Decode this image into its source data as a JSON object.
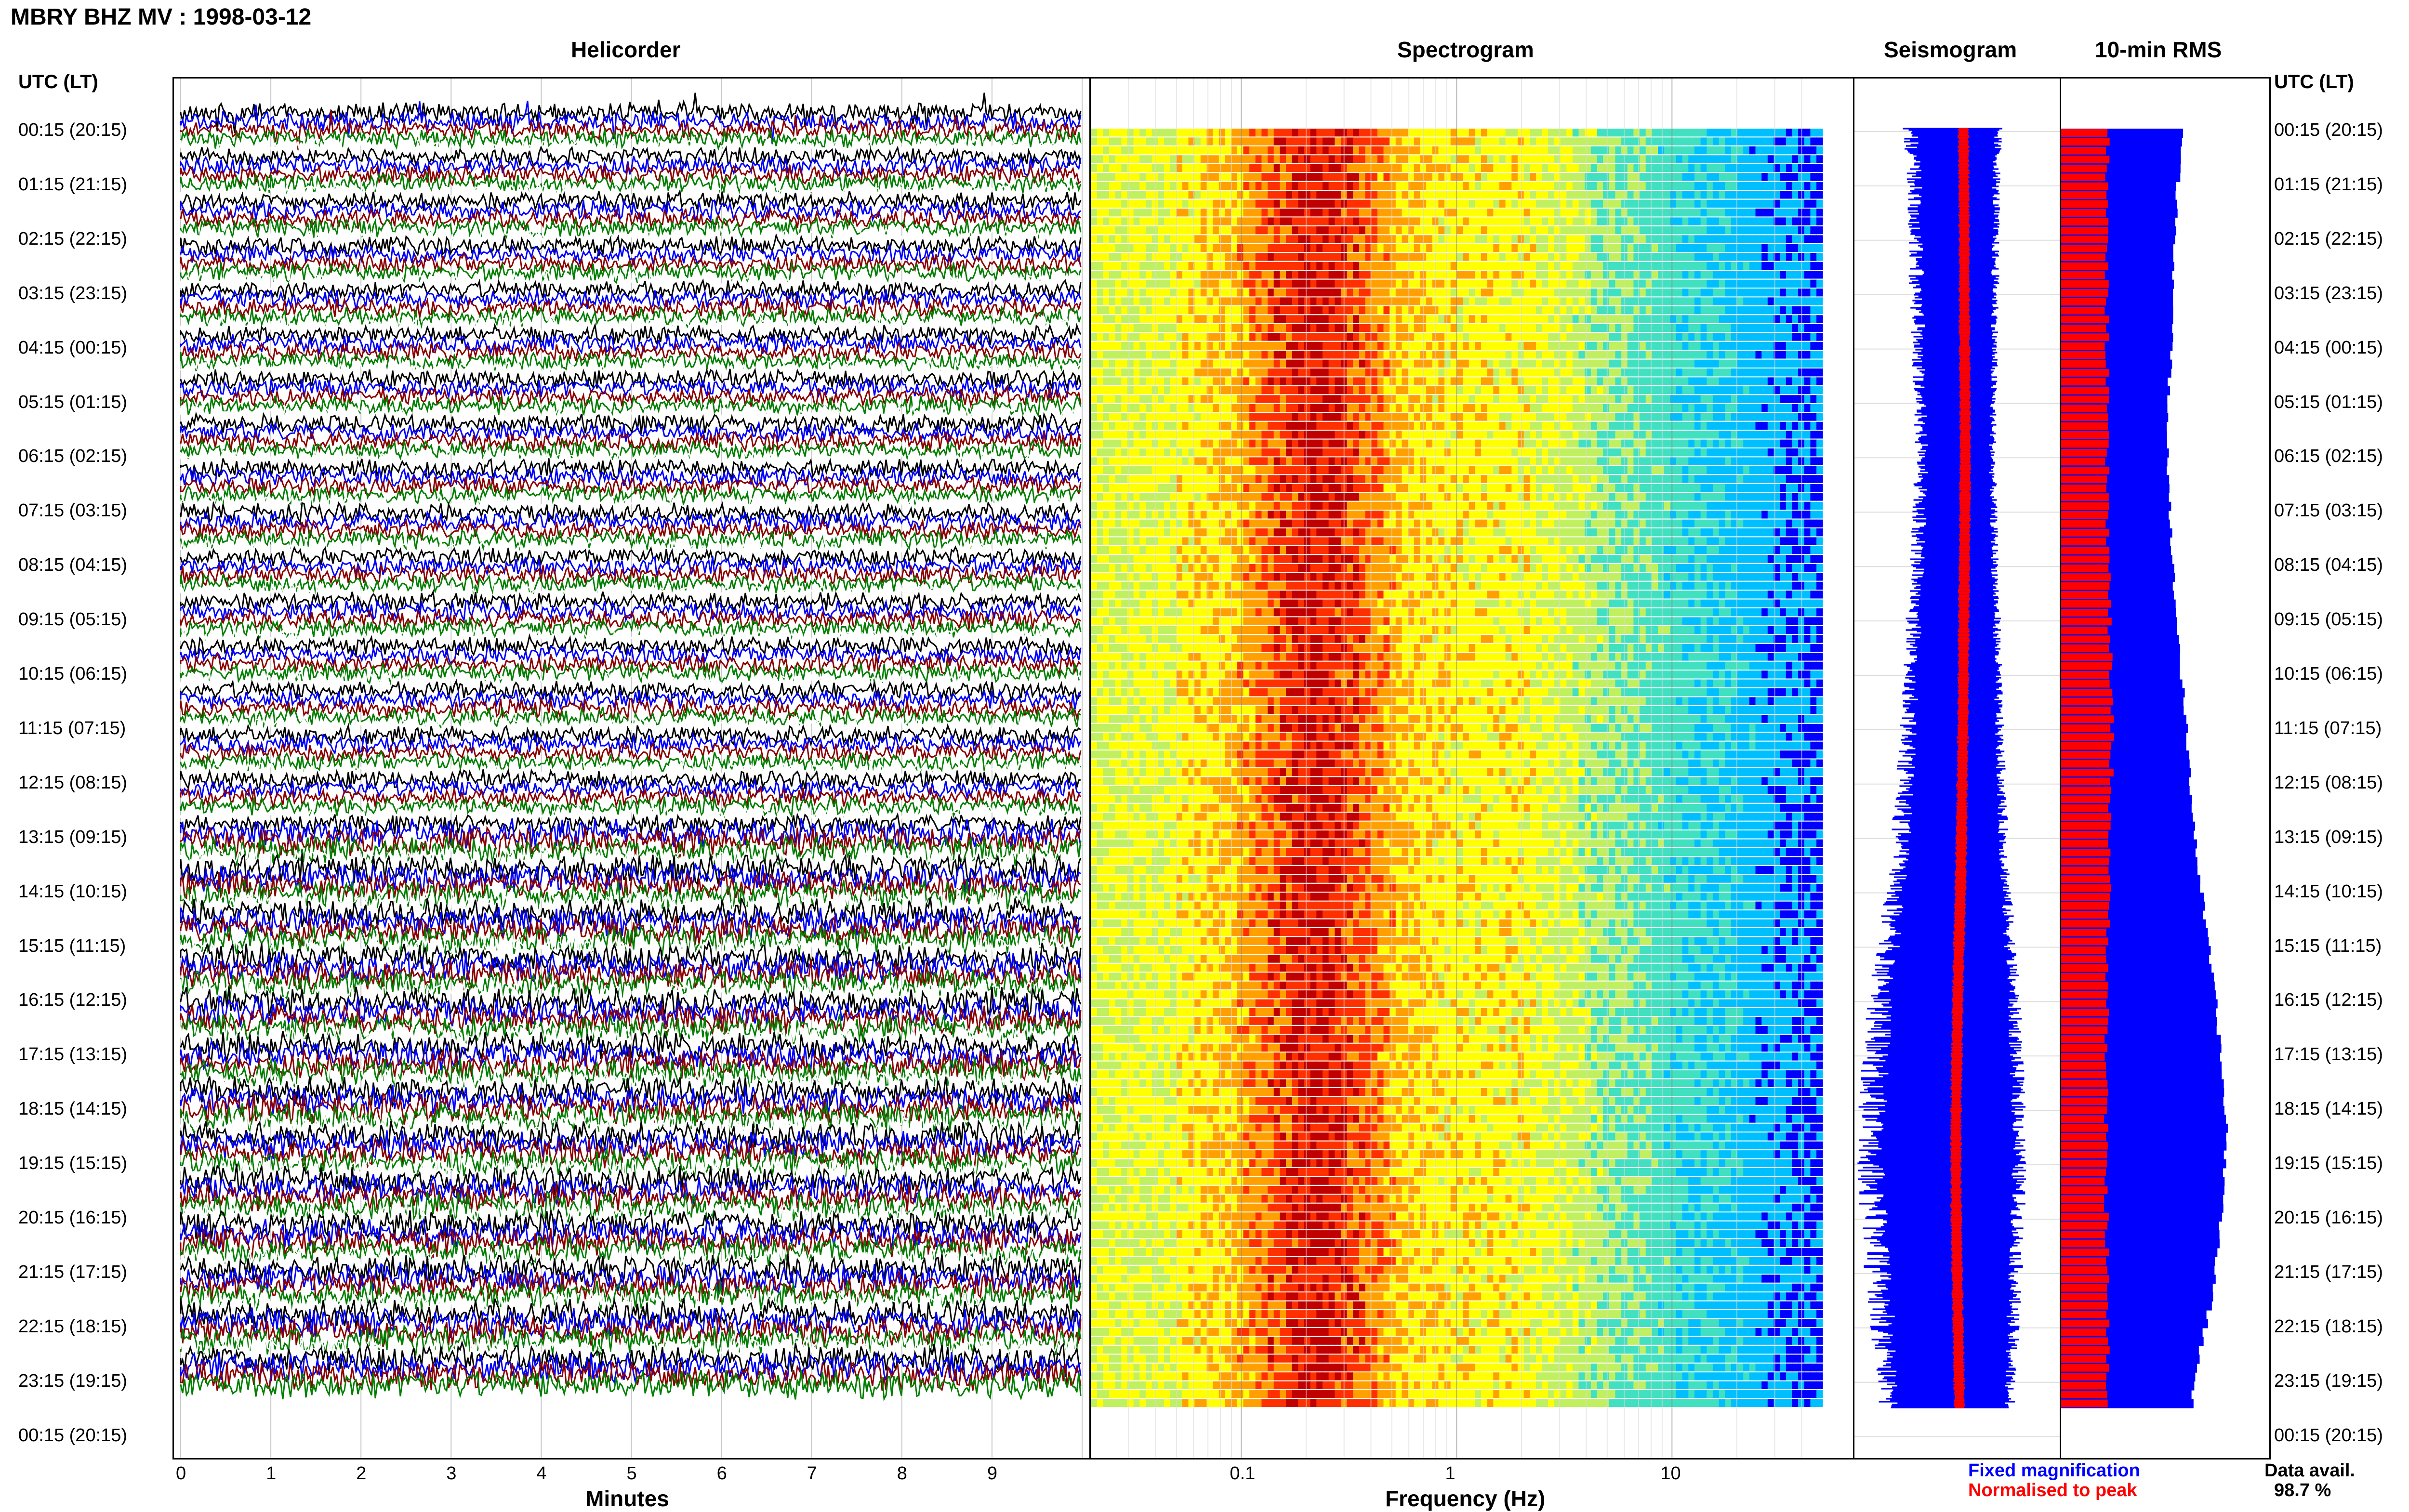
{
  "header": {
    "title": "MBRY BHZ MV : 1998-03-12",
    "left_axis_label": "UTC (LT)",
    "right_axis_label": "UTC (LT)"
  },
  "panels": {
    "helicorder_title": "Helicorder",
    "spectrogram_title": "Spectrogram",
    "seismogram_title": "Seismogram",
    "rms_title": "10-min RMS"
  },
  "legend": {
    "fixed": "Fixed magnification",
    "normalised": "Normalised to peak",
    "fixed_color": "#0000ff",
    "normalised_color": "#ff0000",
    "data_avail_label": "Data avail.",
    "data_avail_value": "98.7 %"
  },
  "chart_data": [
    {
      "type": "line",
      "title": "Helicorder",
      "xlabel": "Minutes",
      "x_ticks": [
        "0",
        "1",
        "2",
        "3",
        "4",
        "5",
        "6",
        "7",
        "8",
        "9"
      ],
      "xlim": [
        0,
        10
      ],
      "y_ticks": [
        "00:15 (20:15)",
        "01:15 (21:15)",
        "02:15 (22:15)",
        "03:15 (23:15)",
        "04:15 (00:15)",
        "05:15 (01:15)",
        "06:15 (02:15)",
        "07:15 (03:15)",
        "08:15 (04:15)",
        "09:15 (05:15)",
        "10:15 (06:15)",
        "11:15 (07:15)",
        "12:15 (08:15)",
        "13:15 (09:15)",
        "14:15 (10:15)",
        "15:15 (11:15)",
        "16:15 (12:15)",
        "17:15 (13:15)",
        "18:15 (14:15)",
        "19:15 (15:15)",
        "20:15 (16:15)",
        "21:15 (17:15)",
        "22:15 (18:15)",
        "23:15 (19:15)",
        "00:15 (20:15)"
      ],
      "trace_colors": [
        "#000000",
        "#0000ff",
        "#8b0000",
        "#007f00",
        "#ffffff"
      ],
      "grid": true
    },
    {
      "type": "heatmap",
      "title": "Spectrogram",
      "xlabel": "Frequency (Hz)",
      "x_scale": "log",
      "x_ticks": [
        "0.1",
        "1",
        "10"
      ],
      "xlim": [
        0.02,
        50
      ]
    },
    {
      "type": "area",
      "title": "Seismogram",
      "fixed_profile": [
        0.55,
        0.52,
        0.5,
        0.5,
        0.48,
        0.46,
        0.45,
        0.47,
        0.5,
        0.53,
        0.55,
        0.58,
        0.62,
        0.66,
        0.72,
        0.8,
        0.86,
        0.9,
        0.94,
        0.93,
        0.9,
        0.85,
        0.8,
        0.75
      ],
      "normalised_width": 0.22
    },
    {
      "type": "bar",
      "title": "10-min RMS",
      "fixed_profile": [
        0.52,
        0.5,
        0.49,
        0.48,
        0.47,
        0.46,
        0.46,
        0.47,
        0.48,
        0.5,
        0.52,
        0.54,
        0.56,
        0.58,
        0.61,
        0.64,
        0.67,
        0.69,
        0.71,
        0.7,
        0.68,
        0.65,
        0.6,
        0.56
      ],
      "normalised_profile": [
        0.52,
        0.49,
        0.5,
        0.5,
        0.5,
        0.5,
        0.5,
        0.51,
        0.52,
        0.53,
        0.54,
        0.56,
        0.54,
        0.53,
        0.52,
        0.51,
        0.5,
        0.49,
        0.49,
        0.49,
        0.5,
        0.5,
        0.51,
        0.5
      ]
    }
  ]
}
